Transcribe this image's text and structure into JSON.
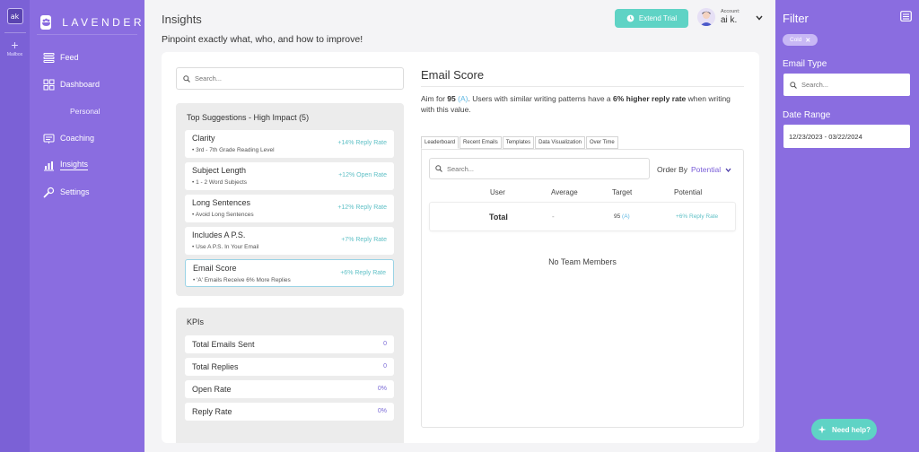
{
  "rail": {
    "avatar_text": "ak",
    "add_label": "Mailbox"
  },
  "brand": {
    "name": "LAVENDER"
  },
  "nav": {
    "feed": "Feed",
    "dashboard": "Dashboard",
    "personal": "Personal",
    "coaching": "Coaching",
    "insights": "Insights",
    "settings": "Settings"
  },
  "header": {
    "title": "Insights",
    "subtitle": "Pinpoint exactly what, who, and how to improve!",
    "trial_button": "Extend Trial",
    "account_label": "Account:",
    "account_name": "ai k."
  },
  "left": {
    "search_placeholder": "Search...",
    "suggestions_title": "Top Suggestions - High Impact (5)",
    "suggestions": [
      {
        "title": "Clarity",
        "desc": "• 3rd - 7th Grade Reading Level",
        "rate": "+14% Reply Rate"
      },
      {
        "title": "Subject Length",
        "desc": "• 1 - 2 Word Subjects",
        "rate": "+12% Open Rate"
      },
      {
        "title": "Long Sentences",
        "desc": "• Avoid Long Sentences",
        "rate": "+12% Reply Rate"
      },
      {
        "title": "Includes A P.S.",
        "desc": "• Use A P.S. In Your Email",
        "rate": "+7% Reply Rate"
      },
      {
        "title": "Email Score",
        "desc": "• 'A' Emails Receive 6% More Replies",
        "rate": "+6% Reply Rate"
      }
    ],
    "kpis_title": "KPIs",
    "kpis": [
      {
        "label": "Total Emails Sent",
        "value": "0"
      },
      {
        "label": "Total Replies",
        "value": "0"
      },
      {
        "label": "Open Rate",
        "value": "0%"
      },
      {
        "label": "Reply Rate",
        "value": "0%"
      }
    ]
  },
  "score": {
    "title": "Email Score",
    "desc_pre": "Aim for ",
    "desc_value": "95",
    "desc_grade": "(A)",
    "desc_mid": ". Users with similar writing patterns have a ",
    "desc_highlight": "6% higher reply rate",
    "desc_post": " when writing with this value.",
    "tabs": [
      "Leaderboard",
      "Recent Emails",
      "Templates",
      "Data Visualization",
      "Over Time"
    ],
    "search_placeholder": "Search...",
    "order_by_label": "Order By",
    "order_by_value": "Potential",
    "columns": {
      "user": "User",
      "average": "Average",
      "target": "Target",
      "potential": "Potential"
    },
    "total_row": {
      "label": "Total",
      "average": "-",
      "target": "95",
      "target_grade": "(A)",
      "potential": "+6% Reply Rate"
    },
    "empty_text": "No Team Members"
  },
  "filter": {
    "title": "Filter",
    "chip": "Cold",
    "email_type_label": "Email Type",
    "email_type_placeholder": "Search...",
    "date_range_label": "Date Range",
    "date_range_value": "12/23/2023 - 03/22/2024"
  },
  "help": {
    "label": "Need help?"
  },
  "colors": {
    "sidebar": "#8a6de0",
    "rail": "#7b61d6",
    "accent_teal": "#5fd3c5",
    "accent_purple": "#7a5ed8"
  }
}
